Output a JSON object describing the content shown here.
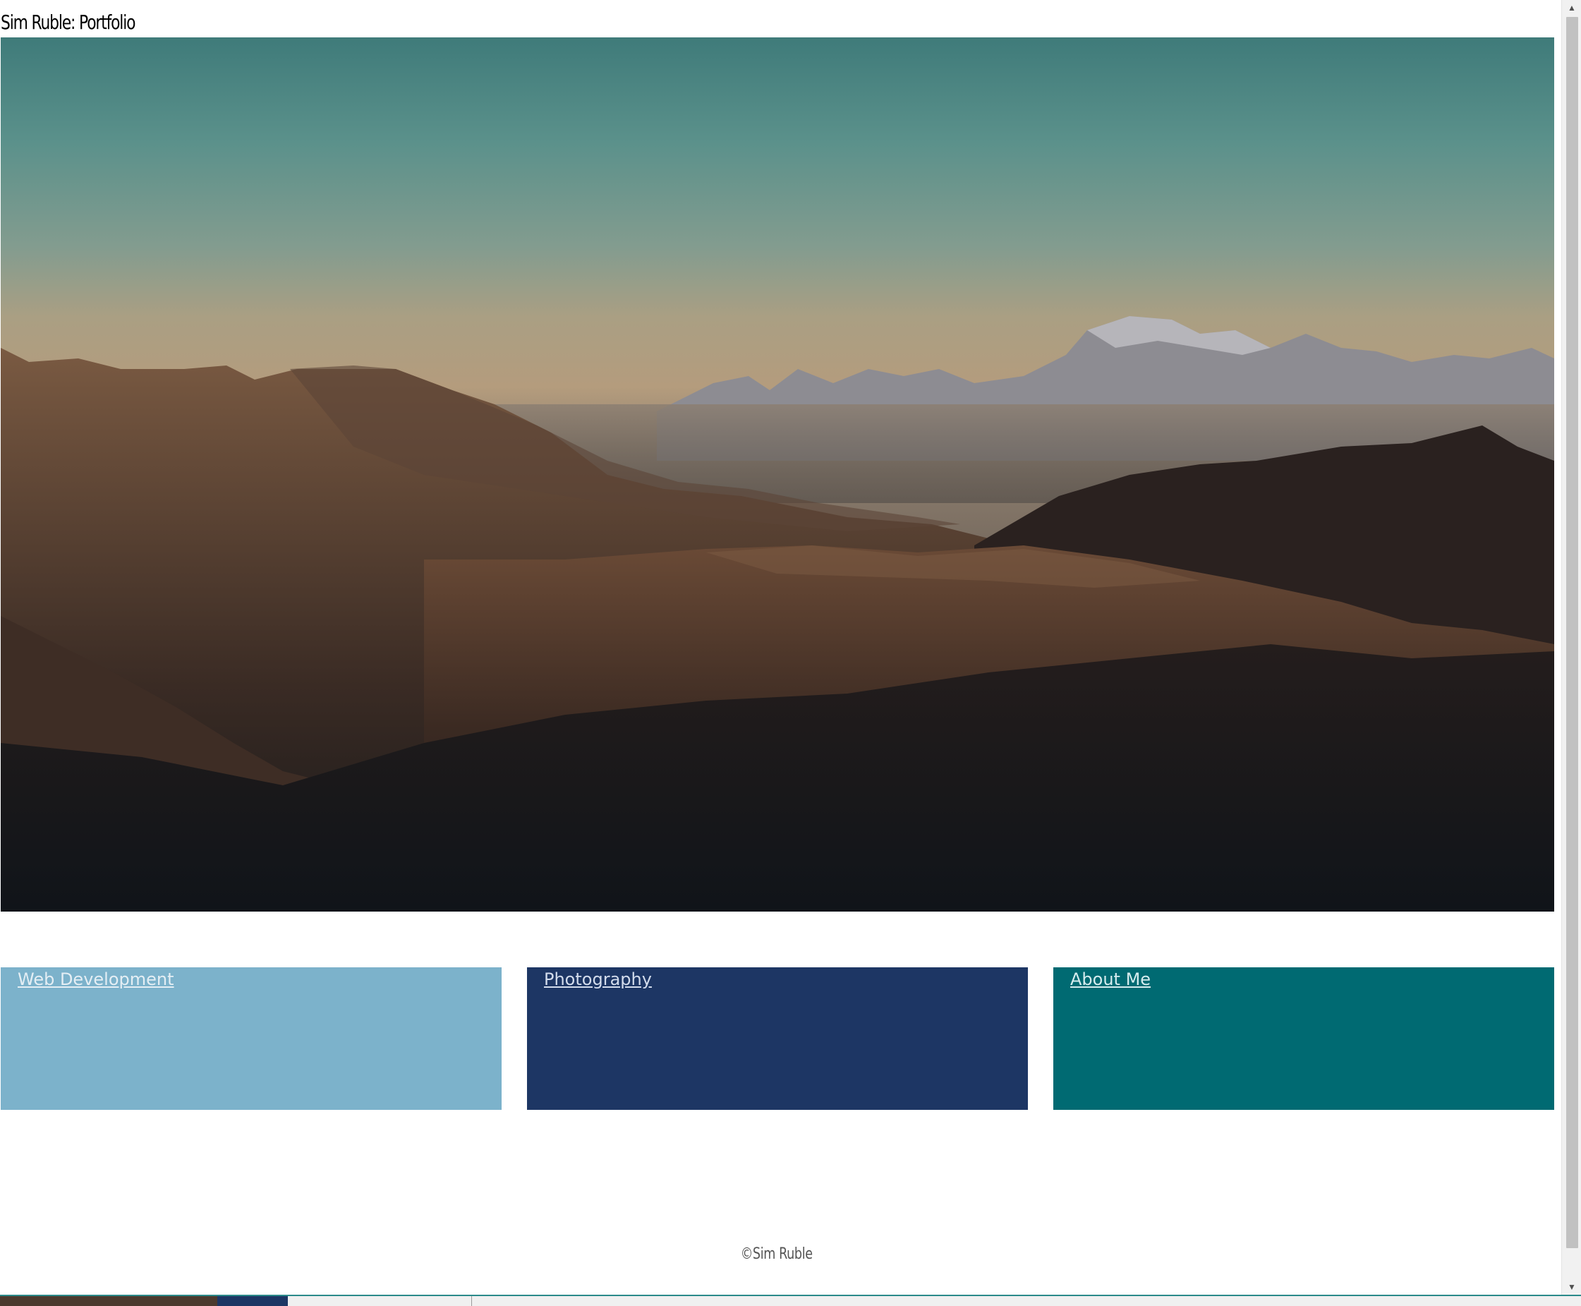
{
  "header": {
    "title": "Sim Ruble: Portfolio"
  },
  "hero": {
    "image_description_icon": "mountain-landscape-photo"
  },
  "tiles": [
    {
      "label": "Web Development",
      "color": "#7cb2cb"
    },
    {
      "label": "Photography",
      "color": "#1d3664"
    },
    {
      "label": "About Me",
      "color": "#006a72"
    }
  ],
  "footer": {
    "copyright": "©Sim Ruble"
  },
  "scrollbar": {
    "up_icon": "scroll-up-arrow-icon",
    "down_icon": "scroll-down-arrow-icon"
  }
}
